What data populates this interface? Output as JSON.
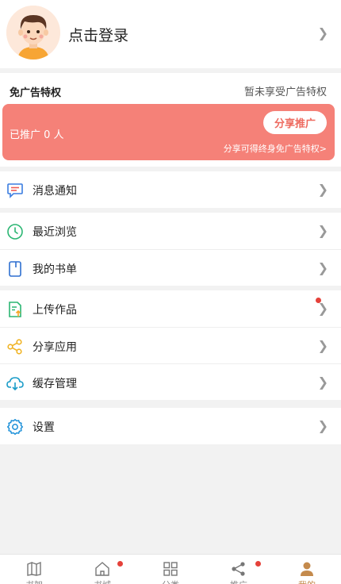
{
  "profile": {
    "login_label": "点击登录"
  },
  "promo": {
    "title": "免广告特权",
    "status": "暂未享受广告特权",
    "count_label": "已推广 0 人",
    "share_button": "分享推广",
    "hint": "分享可得终身免广告特权>"
  },
  "menu": {
    "notifications": "消息通知",
    "recent": "最近浏览",
    "my_booklist": "我的书单",
    "upload": "上传作品",
    "share_app": "分享应用",
    "cache": "缓存管理",
    "settings": "设置"
  },
  "tabs": [
    {
      "label": "书架",
      "icon": "bookshelf-icon"
    },
    {
      "label": "书城",
      "icon": "home-icon",
      "badge": true
    },
    {
      "label": "分类",
      "icon": "grid-icon"
    },
    {
      "label": "推广",
      "icon": "share-icon",
      "badge": true
    },
    {
      "label": "我的",
      "icon": "profile-icon",
      "active": true
    }
  ],
  "colors": {
    "promo_card": "#f58178",
    "badge": "#e5413a",
    "active_tab": "#c48a4c"
  }
}
